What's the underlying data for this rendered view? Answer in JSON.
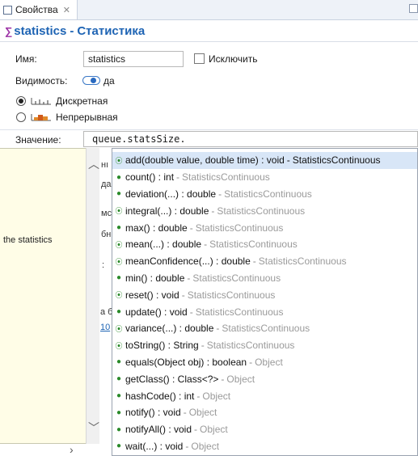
{
  "tab": {
    "label": "Свойства",
    "close": "✕"
  },
  "header": {
    "name": "statistics",
    "separator": "-",
    "type": "Статистика"
  },
  "form": {
    "name_label": "Имя:",
    "name_value": "statistics",
    "exclude_label": "Исключить",
    "visibility_label": "Видимость:",
    "visibility_value": "да",
    "discrete_label": "Дискретная",
    "continuous_label": "Непрерывная",
    "value_label": "Значение:",
    "value_text": "queue.statsSize."
  },
  "doc_popup": {
    "text": "the statistics"
  },
  "background_fragments": [
    "нı",
    "да",
    "мс",
    "бн",
    ":",
    "а б",
    "10"
  ],
  "completions": [
    {
      "signature": "add(double value, double time) : void",
      "owner": "StatisticsContinuous",
      "icon": "override-icon",
      "selected": true
    },
    {
      "signature": "count() : int",
      "owner": "StatisticsContinuous",
      "icon": "method-icon"
    },
    {
      "signature": "deviation(...) : double",
      "owner": "StatisticsContinuous",
      "icon": "method-icon"
    },
    {
      "signature": "integral(...) : double",
      "owner": "StatisticsContinuous",
      "icon": "override-icon"
    },
    {
      "signature": "max() : double",
      "owner": "StatisticsContinuous",
      "icon": "method-icon"
    },
    {
      "signature": "mean(...) : double",
      "owner": "StatisticsContinuous",
      "icon": "override-icon"
    },
    {
      "signature": "meanConfidence(...) : double",
      "owner": "StatisticsContinuous",
      "icon": "override-icon"
    },
    {
      "signature": "min() : double",
      "owner": "StatisticsContinuous",
      "icon": "method-icon"
    },
    {
      "signature": "reset() : void",
      "owner": "StatisticsContinuous",
      "icon": "override-icon"
    },
    {
      "signature": "update() : void",
      "owner": "StatisticsContinuous",
      "icon": "method-icon"
    },
    {
      "signature": "variance(...) : double",
      "owner": "StatisticsContinuous",
      "icon": "override-icon"
    },
    {
      "signature": "toString() : String",
      "owner": "StatisticsContinuous",
      "icon": "override-icon"
    },
    {
      "signature": "equals(Object obj) : boolean",
      "owner": "Object",
      "icon": "method-icon"
    },
    {
      "signature": "getClass() : Class<?>",
      "owner": "Object",
      "icon": "method-icon"
    },
    {
      "signature": "hashCode() : int",
      "owner": "Object",
      "icon": "method-icon"
    },
    {
      "signature": "notify() : void",
      "owner": "Object",
      "icon": "method-icon"
    },
    {
      "signature": "notifyAll() : void",
      "owner": "Object",
      "icon": "method-icon"
    },
    {
      "signature": "wait(...) : void",
      "owner": "Object",
      "icon": "method-icon"
    }
  ],
  "colors": {
    "accent": "#1e64b4",
    "doc_bg": "#fffde7",
    "selection": "#d8e6f7",
    "owner_text": "#9a9a9a"
  }
}
